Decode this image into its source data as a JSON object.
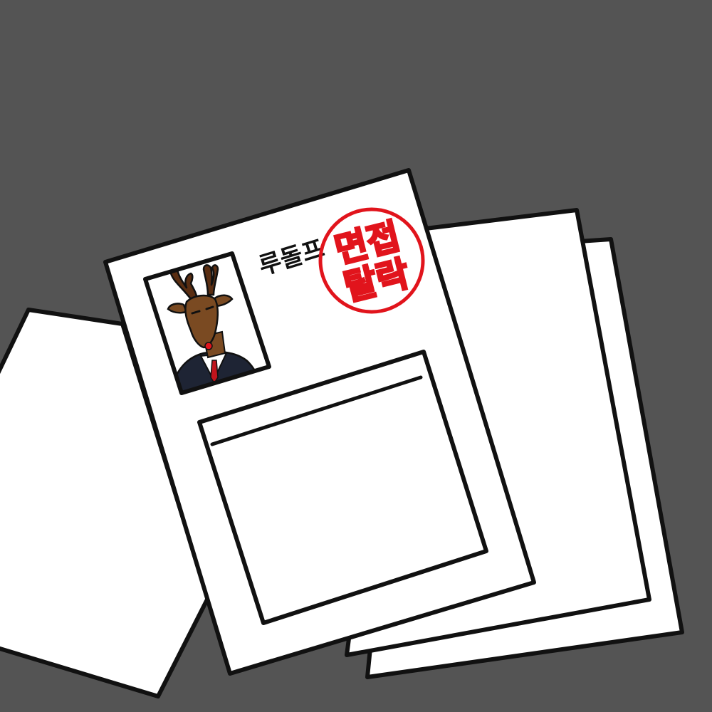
{
  "scene": {
    "background_color": "#545454",
    "paper_color": "#ffffff",
    "outline_color": "#111111"
  },
  "resume": {
    "name": "루돌프",
    "stamp": {
      "line1": "면접",
      "line2": "탈락",
      "color": "#e1141c"
    },
    "photo": {
      "icon": "reindeer-portrait-icon"
    }
  }
}
